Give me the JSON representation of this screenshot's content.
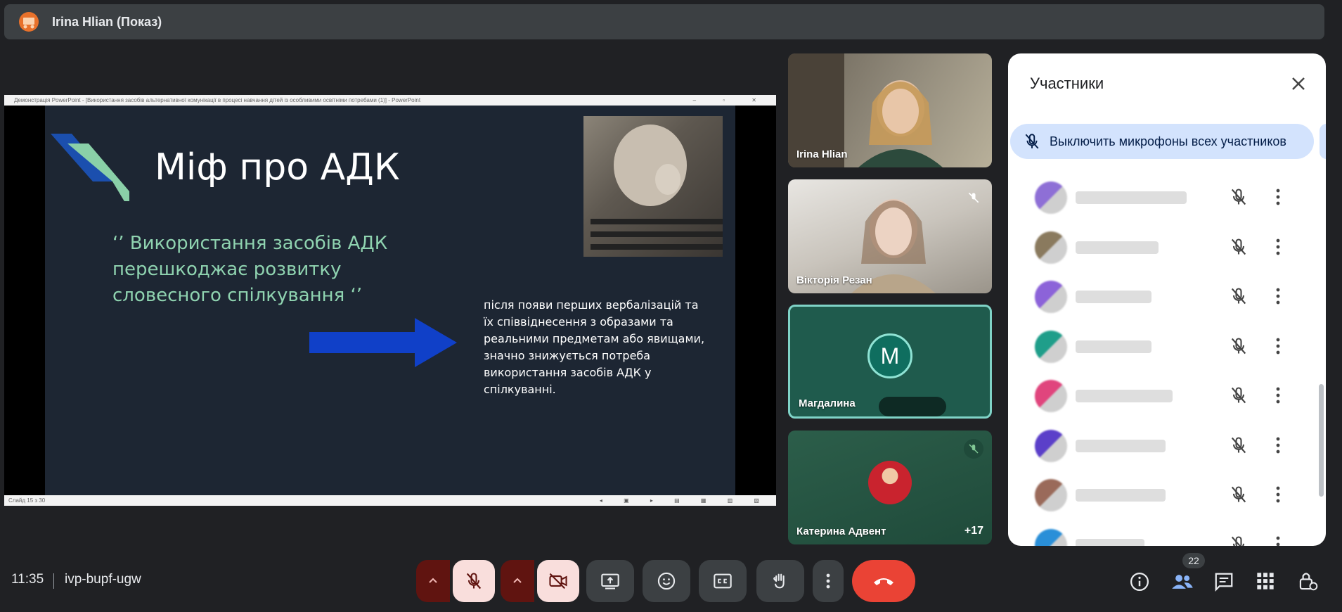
{
  "topbar": {
    "title": "Irina Hlian (Показ)",
    "icon": "presentation-icon"
  },
  "share": {
    "window_title": "Демонстрація PowerPoint - [Використання засобів альтернативної комунікації в процесі навчання дітей із особливими освітніми потребами (1)] - PowerPoint",
    "status_text": "Слайд 15 з 30",
    "slide": {
      "title": "Міф про АДК",
      "quote": "‘’ Використання засобів АДК перешкоджає розвитку словесного спілкування ‘’",
      "body": "після появи перших вербалізацій та їх співвіднесення з образами та реальними предметам або явищами, значно знижується потреба використання засобів АДК у спілкуванні."
    }
  },
  "tiles": [
    {
      "name": "Irina Hlian"
    },
    {
      "name": "Вікторія Резан",
      "muted": true
    },
    {
      "name": "Магдалина",
      "avatar_letter": "M"
    },
    {
      "name": "Катерина Адвент",
      "muted": true,
      "more": "+17"
    }
  ],
  "panel": {
    "title": "Участники",
    "mute_all": "Выключить микрофоны всех участников",
    "participants": [
      {
        "avatar_color": "#8e6fd6",
        "name_width": 158
      },
      {
        "avatar_color": "#8a7a5e",
        "name_width": 118
      },
      {
        "avatar_color": "#8c63d9",
        "name_width": 108
      },
      {
        "avatar_color": "#1f9e8a",
        "name_width": 108
      },
      {
        "avatar_color": "#e0457d",
        "name_width": 138
      },
      {
        "avatar_color": "#5b3fc9",
        "name_width": 128
      },
      {
        "avatar_color": "#9a6a5a",
        "name_width": 128
      },
      {
        "avatar_color": "#2a8fd8",
        "name_width": 98
      }
    ]
  },
  "bottom": {
    "time": "11:35",
    "meeting_code": "ivp-bupf-ugw",
    "participants_count": "22"
  },
  "colors": {
    "danger": "#ea4335",
    "muted_red": "#f9dedc",
    "dark_red": "#601410",
    "accent": "#8ab4f8"
  }
}
